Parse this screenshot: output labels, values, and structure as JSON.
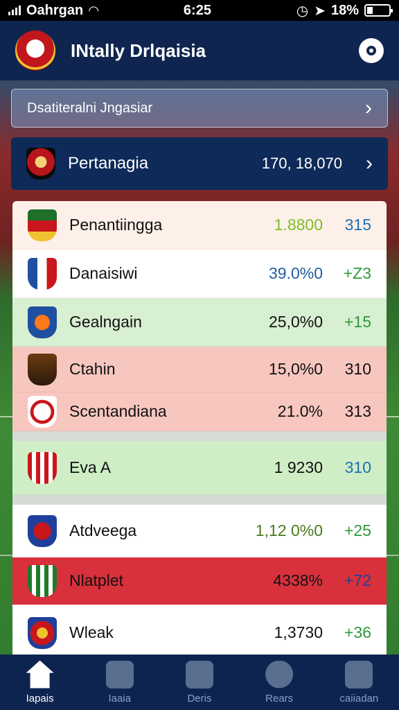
{
  "status": {
    "carrier": "Oahrgan",
    "time": "6:25",
    "battery": "18%"
  },
  "header": {
    "title": "INtally Drlqaisia"
  },
  "filter": {
    "label": "Dsatiteralni Jngasiar"
  },
  "featured": {
    "name": "Pertanagia",
    "value": "170, 18,070"
  },
  "colors": {
    "navy": "#0e2a58",
    "up": "#2e9a3a",
    "down": "#c21f2a",
    "blue_pts": "#1f6fb3"
  },
  "rows": [
    {
      "name": "Penantiingga",
      "value": "1.8800",
      "points": "315",
      "bg": "#fdf0e8",
      "value_color": "#7fbf2a",
      "points_color": "#1f6fb3"
    },
    {
      "name": "Danaisiwi",
      "value": "39.0%0",
      "points": "+Z3",
      "bg": "#ffffff",
      "value_color": "#1f5fa0",
      "points_color": "#2e9a3a"
    },
    {
      "name": "Gealngain",
      "value": "25,0%0",
      "points": "+15",
      "bg": "#d8f0d2",
      "value_color": "#111111",
      "points_color": "#2e9a3a"
    },
    {
      "name": "Ctahin",
      "value": "15,0%0",
      "points": "310",
      "bg": "#f7c6bf",
      "value_color": "#111111",
      "points_color": "#111111"
    },
    {
      "name": "Scentandiana",
      "value": "21.0%",
      "points": "313",
      "bg": "#f7c6bf",
      "value_color": "#111111",
      "points_color": "#111111"
    },
    {
      "name": "Eva A",
      "value": "1 9230",
      "points": "310",
      "bg": "#cfeec6",
      "value_color": "#111111",
      "points_color": "#1f6fb3"
    },
    {
      "name": "Atdveega",
      "value": "1,12 0%0",
      "points": "+25",
      "bg": "#ffffff",
      "value_color": "#4a7a1e",
      "points_color": "#2e9a3a"
    },
    {
      "name": "Nlatplet",
      "value": "4338%",
      "points": "+72",
      "bg": "#d8313c",
      "value_color": "#111111",
      "points_color": "#1f3f9a"
    },
    {
      "name": "Wleak",
      "value": "1,3730",
      "points": "+36",
      "bg": "#ffffff",
      "value_color": "#111111",
      "points_color": "#2e9a3a"
    }
  ],
  "tabs": [
    {
      "label": "Iapais",
      "icon": "home-icon"
    },
    {
      "label": "Iaaia",
      "icon": "tools-icon"
    },
    {
      "label": "Deris",
      "icon": "teams-icon"
    },
    {
      "label": "Rears",
      "icon": "refresh-icon"
    },
    {
      "label": "caiiadan",
      "icon": "profile-icon"
    }
  ]
}
